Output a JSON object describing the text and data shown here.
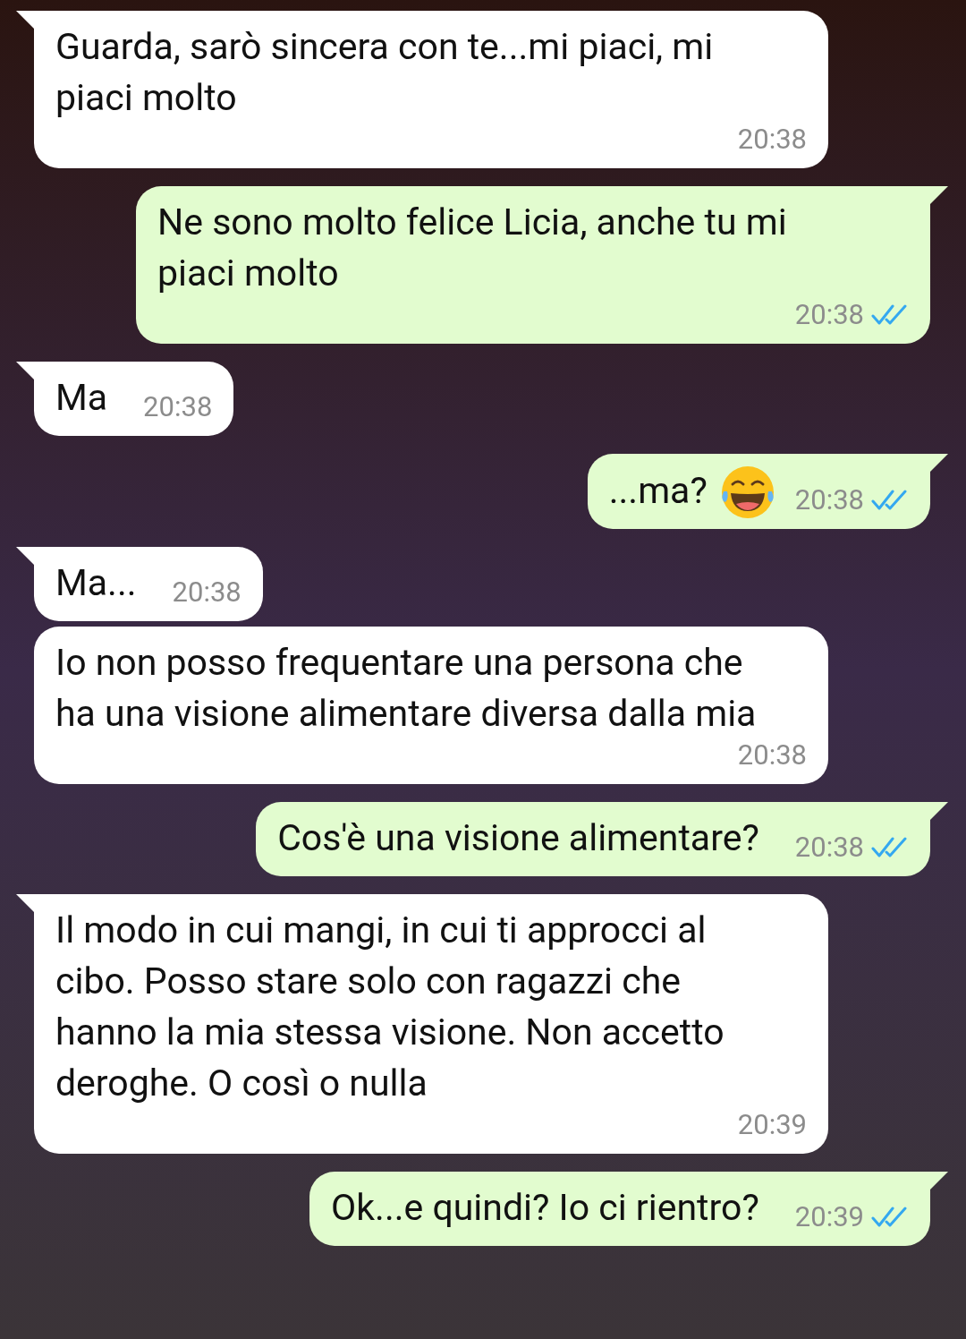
{
  "messages": [
    {
      "kind": "incoming",
      "text": "Guarda, sarò sincera con te...mi piaci, mi piaci molto",
      "time": "20:38"
    },
    {
      "kind": "outgoing",
      "text": "Ne sono molto felice Licia, anche tu mi piaci molto",
      "time": "20:38",
      "read": true
    },
    {
      "kind": "incoming",
      "text": "Ma",
      "time": "20:38"
    },
    {
      "kind": "outgoing-emoji",
      "text": "...ma?",
      "time": "20:38",
      "read": true
    },
    {
      "kind": "incoming",
      "text": "Ma...",
      "time": "20:38"
    },
    {
      "kind": "incoming",
      "text": "Io non posso frequentare una persona che ha una visione alimentare diversa dalla mia",
      "time": "20:38"
    },
    {
      "kind": "outgoing",
      "text": "Cos'è una visione alimentare?",
      "time": "20:38",
      "read": true
    },
    {
      "kind": "incoming",
      "text": "Il modo in cui mangi, in cui ti approcci al cibo. Posso stare solo con ragazzi che hanno la mia stessa visione. Non accetto deroghe. O così o nulla",
      "time": "20:39"
    },
    {
      "kind": "outgoing",
      "text": "Ok...e quindi? Io ci rientro?",
      "time": "20:39",
      "read": true
    }
  ]
}
